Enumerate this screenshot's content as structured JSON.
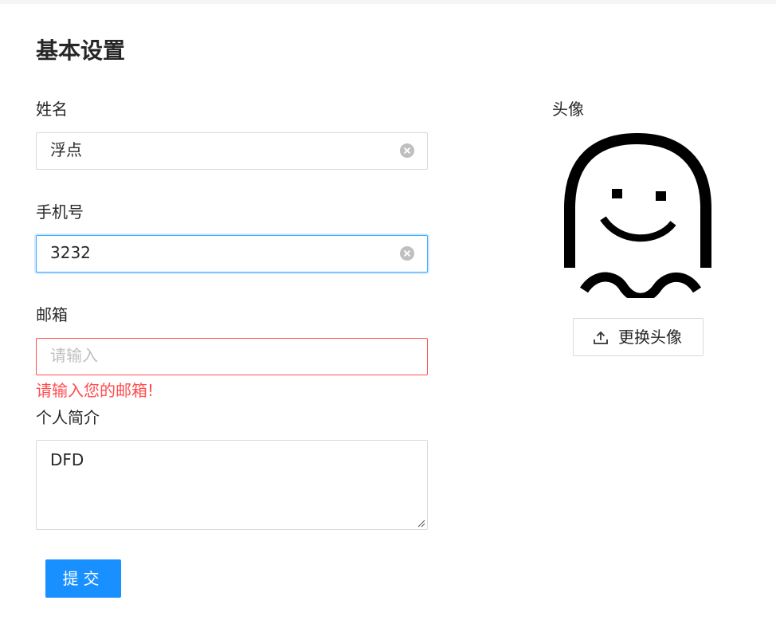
{
  "page": {
    "title": "基本设置"
  },
  "form": {
    "name": {
      "label": "姓名",
      "value": "浮点"
    },
    "phone": {
      "label": "手机号",
      "value": "3232"
    },
    "email": {
      "label": "邮箱",
      "placeholder": "请输入",
      "value": "",
      "error": "请输入您的邮箱!"
    },
    "bio": {
      "label": "个人简介",
      "value": "DFD"
    },
    "submit_label": "提交"
  },
  "avatar": {
    "label": "头像",
    "upload_label": "更换头像",
    "icon": "ghost-avatar"
  },
  "colors": {
    "primary": "#1890ff",
    "error": "#ff4d4f",
    "focus_border": "#40a9ff"
  }
}
